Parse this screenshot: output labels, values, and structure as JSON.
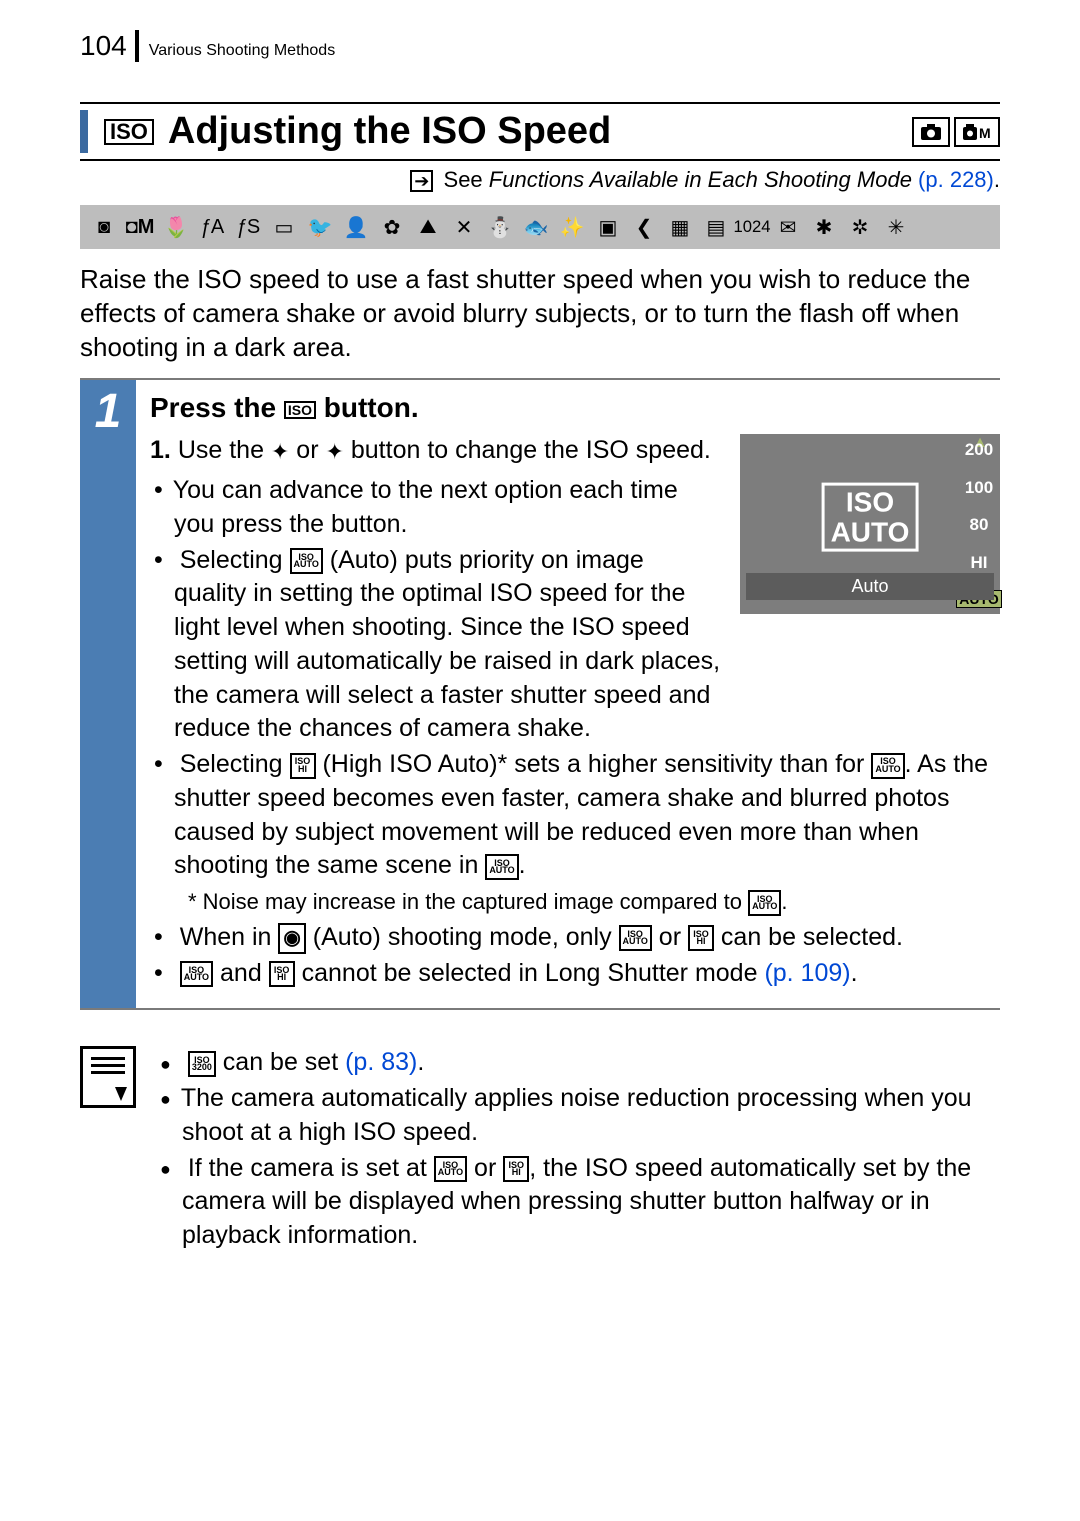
{
  "page": {
    "number": "104",
    "header": "Various Shooting Methods"
  },
  "section": {
    "icon_label": "ISO",
    "title": "Adjusting the ISO Speed"
  },
  "see_link": {
    "prefix": "See ",
    "italic": "Functions Available in Each Shooting Mode",
    "page_ref": " (p. 228)",
    "period": "."
  },
  "intro": "Raise the ISO speed to use a fast shutter speed when you wish to reduce the effects of camera shake or avoid blurry subjects, or to turn the flash off when shooting in a dark area.",
  "step": {
    "number": "1",
    "title_pre": "Press the ",
    "title_icon": "ISO",
    "title_post": " button.",
    "ol1_a": "Use the ",
    "ol1_b": " or ",
    "ol1_c": " button to change the ISO speed.",
    "bullet1": "You can advance to the next option each time you press the button.",
    "bullet2_a": "Selecting ",
    "bullet2_b": " (Auto) puts priority on image quality in setting the optimal ISO speed for the light level when shooting. Since the ISO speed setting will automatically be raised in dark places, the camera will select a faster shutter speed and reduce the chances of camera shake.",
    "bullet3_a": "Selecting ",
    "bullet3_b": " (High ISO Auto)* sets a higher sensitivity than for ",
    "bullet3_c": ". As the shutter speed becomes even faster, camera shake and blurred photos caused by subject movement will be reduced even more than when shooting the same scene in ",
    "bullet3_d": ".",
    "note_a": "* Noise may increase in the captured image compared to ",
    "note_b": ".",
    "bullet4_a": "When in ",
    "bullet4_b": " (Auto) shooting mode, only ",
    "bullet4_c": " or ",
    "bullet4_d": " can be selected.",
    "bullet5_a": "",
    "bullet5_b": " and ",
    "bullet5_c": " cannot be selected in Long Shutter mode ",
    "bullet5_link": "(p. 109)",
    "bullet5_d": "."
  },
  "lcd": {
    "center_top": "ISO",
    "center_bot": "AUTO",
    "bottom_bar": "Auto",
    "scale": [
      "200",
      "100",
      "80",
      "HI",
      "AUTO"
    ]
  },
  "icons": {
    "iso_auto_top": "ISO",
    "iso_auto_bot": "AUTO",
    "iso_hi_top": "ISO",
    "iso_hi_bot": "HI",
    "iso_3200_top": "ISO",
    "iso_3200_bot": "3200",
    "camera_mode": "◉"
  },
  "tips": {
    "t1_a": "",
    "t1_b": " can be set ",
    "t1_link": "(p. 83)",
    "t1_c": ".",
    "t2": "The camera automatically applies noise reduction processing when you shoot at a high ISO speed.",
    "t3_a": "If the camera is set at ",
    "t3_b": " or ",
    "t3_c": ", the ISO speed automatically set by the camera will be displayed when pressing shutter button halfway or in playback information."
  }
}
